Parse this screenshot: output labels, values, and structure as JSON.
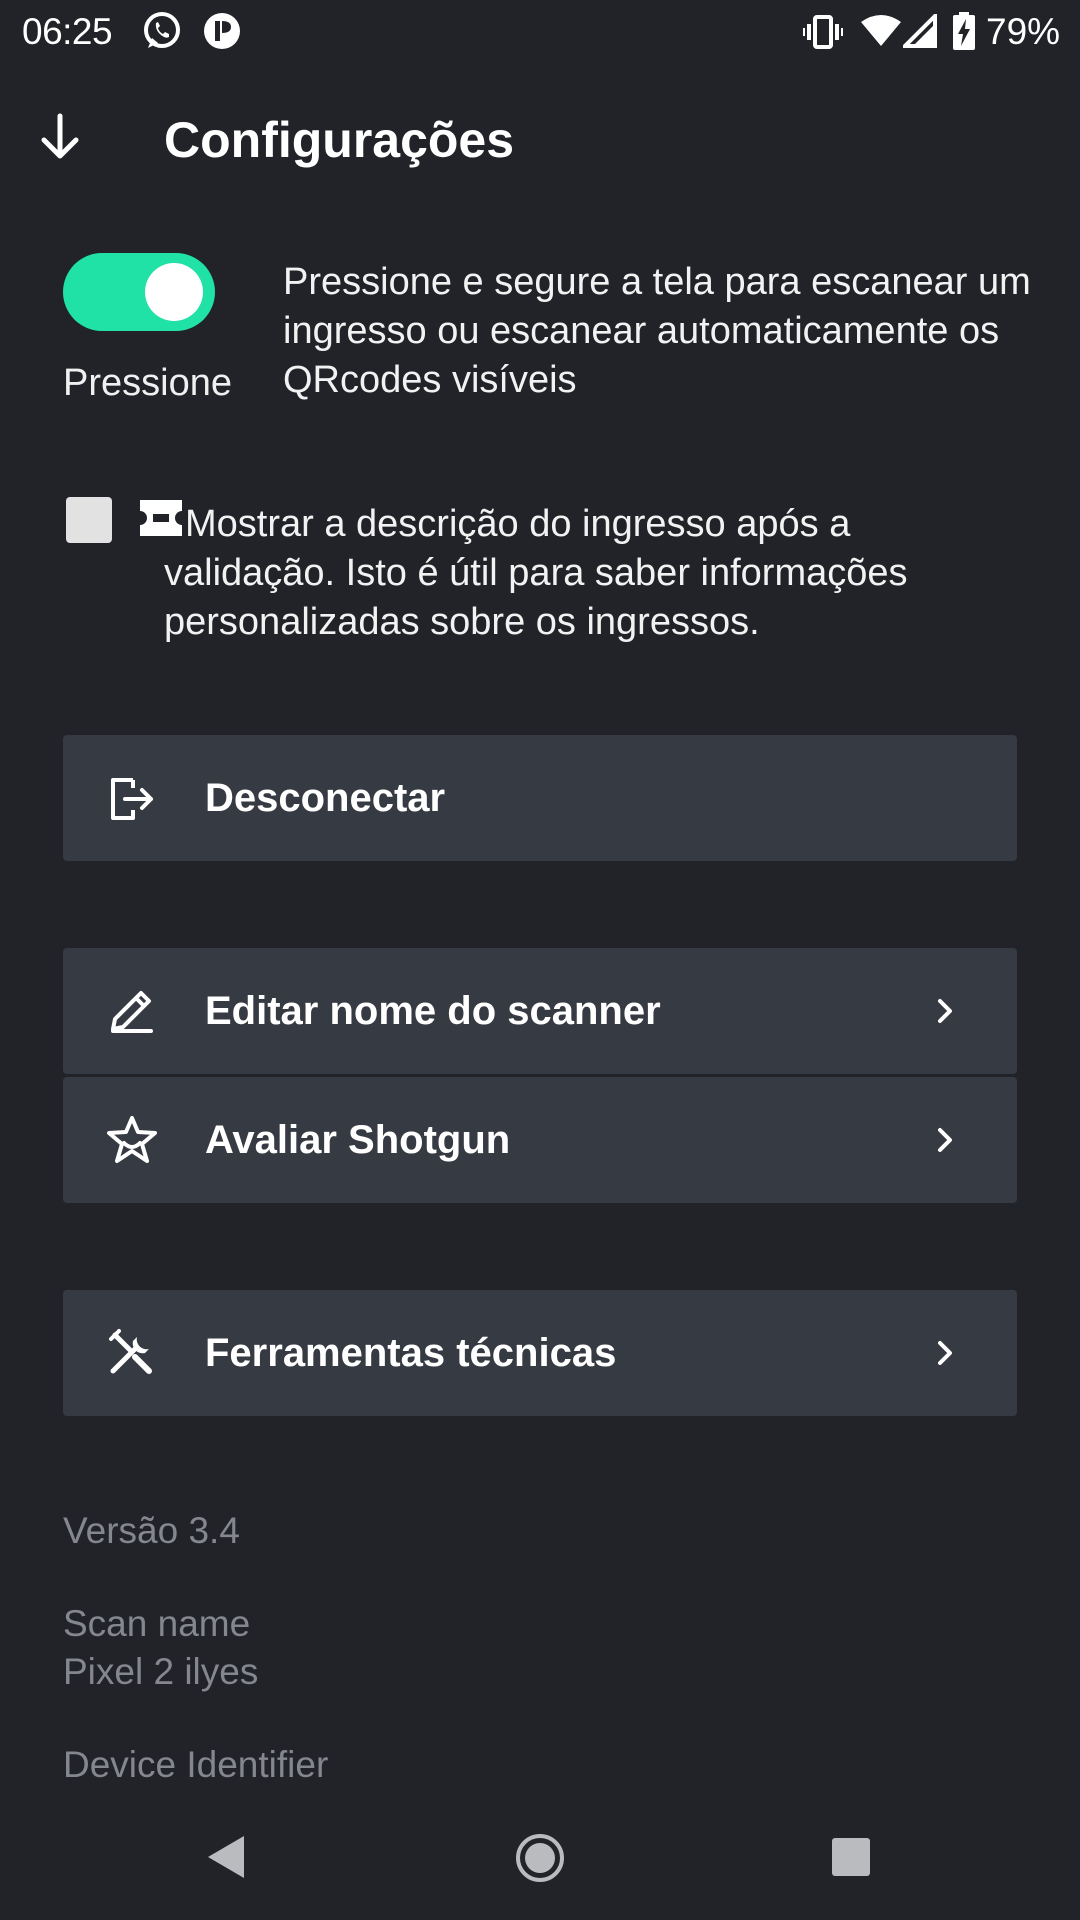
{
  "status_bar": {
    "time": "06:25",
    "battery": "79%",
    "icons": [
      "whatsapp-icon",
      "app-notification-icon",
      "vibrate-icon",
      "wifi-icon",
      "signal-icon",
      "battery-charging-icon"
    ]
  },
  "header": {
    "title": "Configurações",
    "back_icon": "arrow-down-icon"
  },
  "press_setting": {
    "enabled": true,
    "toggle_caption": "Pressione",
    "description": "Pressione e segure a tela para escanear um ingresso ou escanear automaticamente os QRcodes visíveis",
    "accent_color": "#20e1a6"
  },
  "description_setting": {
    "checked": false,
    "icon": "ticket-icon",
    "description_line1": "Mostrar a descrição do ingresso após a",
    "description_rest": "validação. Isto é útil para saber informações personalizadas sobre os ingressos."
  },
  "actions": [
    {
      "label": "Desconectar",
      "icon": "logout-icon",
      "has_chevron": false
    },
    {
      "label": "Editar nome do scanner",
      "icon": "pencil-icon",
      "has_chevron": true
    },
    {
      "label": "Avaliar Shotgun",
      "icon": "star-icon",
      "has_chevron": true
    },
    {
      "label": "Ferramentas técnicas",
      "icon": "tools-icon",
      "has_chevron": true
    }
  ],
  "info": {
    "version": "Versão 3.4",
    "scan_name_label": "Scan name",
    "scan_name_value": "Pixel 2 ilyes",
    "device_identifier_label": "Device Identifier"
  },
  "nav_bar": {
    "icons": [
      "nav-back-icon",
      "nav-home-icon",
      "nav-recents-icon"
    ]
  },
  "colors": {
    "background": "#212328",
    "row_background": "#363a42",
    "muted_text": "#84878d"
  }
}
